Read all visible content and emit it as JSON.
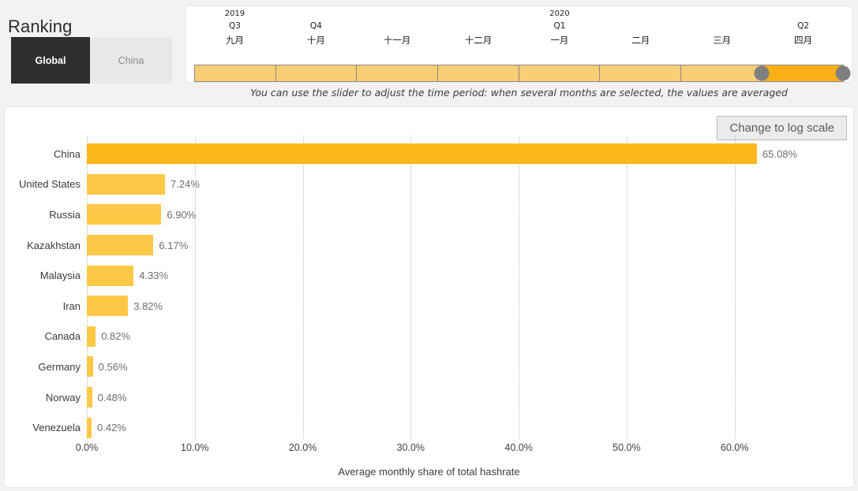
{
  "header": {
    "title": "Ranking",
    "tabs": [
      {
        "label": "Global",
        "active": true
      },
      {
        "label": "China",
        "active": false
      }
    ]
  },
  "slider": {
    "hint": "You can use the slider to adjust the time period: when several months are selected, the values are averaged",
    "columns": [
      {
        "year": "2019",
        "quarter": "Q3",
        "month": "九月",
        "selected": false
      },
      {
        "year": "",
        "quarter": "Q4",
        "month": "十月",
        "selected": false
      },
      {
        "year": "",
        "quarter": "",
        "month": "十一月",
        "selected": false
      },
      {
        "year": "",
        "quarter": "",
        "month": "十二月",
        "selected": false
      },
      {
        "year": "2020",
        "quarter": "Q1",
        "month": "一月",
        "selected": false
      },
      {
        "year": "",
        "quarter": "",
        "month": "二月",
        "selected": false
      },
      {
        "year": "",
        "quarter": "",
        "month": "三月",
        "selected": false
      },
      {
        "year": "",
        "quarter": "Q2",
        "month": "四月",
        "selected": true
      }
    ],
    "handle_left_pct": 87.5,
    "handle_right_pct": 100
  },
  "chart_panel": {
    "log_scale_button": "Change to log scale"
  },
  "chart_data": {
    "type": "bar",
    "orientation": "horizontal",
    "title": "",
    "xlabel": "Average monthly share of total hashrate",
    "ylabel": "",
    "xlim": [
      0,
      65.8
    ],
    "xticks": [
      0,
      10,
      20,
      30,
      40,
      50,
      60
    ],
    "xtick_labels": [
      "0.0%",
      "10.0%",
      "20.0%",
      "30.0%",
      "40.0%",
      "50.0%",
      "60.0%"
    ],
    "grid": true,
    "legend": null,
    "categories": [
      "China",
      "United States",
      "Russia",
      "Kazakhstan",
      "Malaysia",
      "Iran",
      "Canada",
      "Germany",
      "Norway",
      "Venezuela"
    ],
    "values": [
      65.08,
      7.24,
      6.9,
      6.17,
      4.33,
      3.82,
      0.82,
      0.56,
      0.48,
      0.42
    ],
    "value_labels": [
      "65.08%",
      "7.24%",
      "6.90%",
      "6.17%",
      "4.33%",
      "3.82%",
      "0.82%",
      "0.56%",
      "0.48%",
      "0.42%"
    ],
    "colors": {
      "bar": "#fdc845",
      "top_bar": "#fcb71b",
      "grid": "#bdbdbd"
    }
  }
}
